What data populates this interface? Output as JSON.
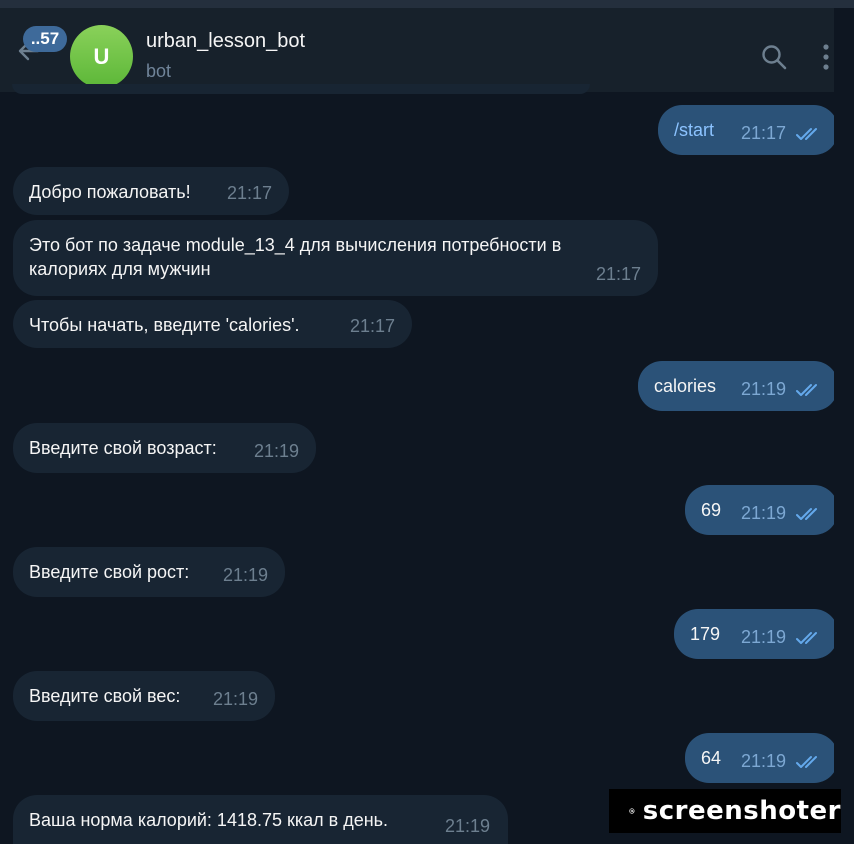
{
  "header": {
    "unread_badge": "..57",
    "avatar_letter": "U",
    "chat_title": "urban_lesson_bot",
    "chat_subtitle": "bot"
  },
  "messages": [
    {
      "direction": "out",
      "text": "/start",
      "time": "21:17"
    },
    {
      "direction": "in",
      "text": "Добро пожаловать!",
      "time": "21:17"
    },
    {
      "direction": "in",
      "text": "Это бот по задаче module_13_4 для вычисления потребности в калориях для мужчин",
      "time": "21:17"
    },
    {
      "direction": "in",
      "text": "Чтобы начать, введите 'calories'.",
      "time": "21:17"
    },
    {
      "direction": "out",
      "text": "calories",
      "time": "21:19"
    },
    {
      "direction": "in",
      "text": "Введите свой возраст:",
      "time": "21:19"
    },
    {
      "direction": "out",
      "text": "69",
      "time": "21:19"
    },
    {
      "direction": "in",
      "text": "Введите свой рост:",
      "time": "21:19"
    },
    {
      "direction": "out",
      "text": "179",
      "time": "21:19"
    },
    {
      "direction": "in",
      "text": "Введите свой вес:",
      "time": "21:19"
    },
    {
      "direction": "out",
      "text": "64",
      "time": "21:19"
    },
    {
      "direction": "in",
      "text": "Ваша норма калорий: 1418.75 ккал в день.",
      "time": "21:19"
    }
  ],
  "watermark": {
    "text": "screenshoter"
  },
  "colors": {
    "background": "#0e1621",
    "header": "#17212b",
    "incoming_bubble": "#182533",
    "outgoing_bubble": "#2b5278",
    "avatar": "#6cc244",
    "read_check": "#64a9ec"
  }
}
